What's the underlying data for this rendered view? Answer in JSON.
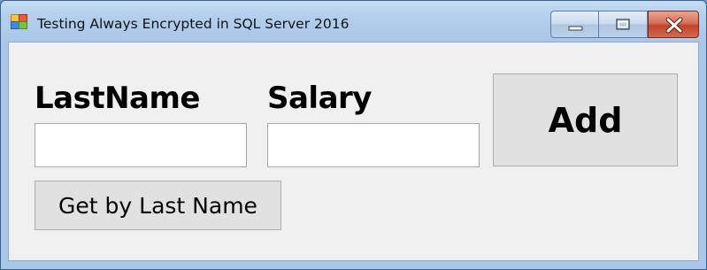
{
  "window": {
    "title": "Testing Always Encrypted in SQL Server 2016",
    "icon": "windows-form-icon",
    "controls": {
      "minimize_icon": "minimize-icon",
      "maximize_icon": "maximize-icon",
      "close_icon": "close-icon"
    },
    "colors": {
      "frame": "#a9c7e8",
      "client": "#f0f0f0",
      "close_button": "#c2432a"
    }
  },
  "form": {
    "lastname_label": "LastName",
    "lastname_value": "",
    "salary_label": "Salary",
    "salary_value": "",
    "add_label": "Add",
    "get_label": "Get by Last Name"
  }
}
